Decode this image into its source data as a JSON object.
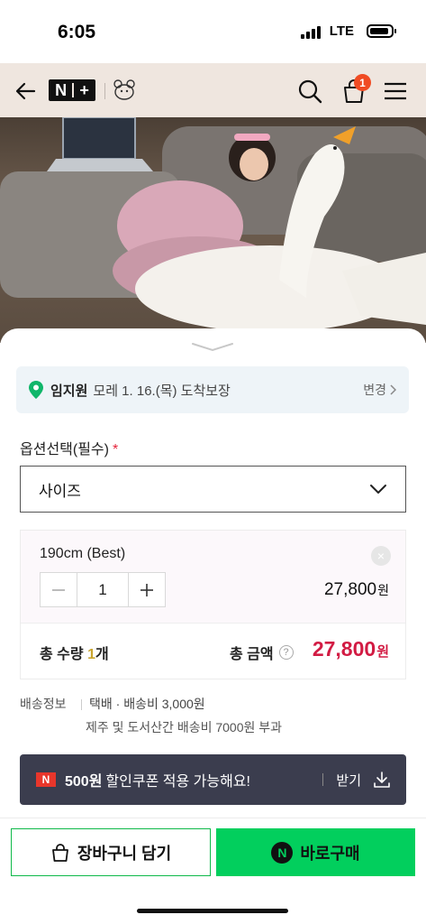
{
  "status_bar": {
    "time": "6:05",
    "network": "LTE"
  },
  "header": {
    "cart_count": "1"
  },
  "delivery": {
    "name": "임지원",
    "date": "모레 1. 16.(목) 도착보장",
    "change_label": "변경"
  },
  "options": {
    "label": "옵션선택(필수)",
    "required_mark": "*",
    "select_value": "사이즈"
  },
  "selected_item": {
    "name": "190cm (Best)",
    "remove_symbol": "×",
    "quantity": "1",
    "price": "27,800",
    "price_unit": "원"
  },
  "totals": {
    "qty_prefix": "총 수량 ",
    "qty_value": "1",
    "qty_unit": "개",
    "amount_label": "총 금액",
    "help_symbol": "?",
    "amount": "27,800",
    "amount_unit": "원"
  },
  "shipping": {
    "label": "배송정보",
    "line1": "택배 · 배송비 3,000원",
    "line2": "제주 및 도서산간 배송비 7000원 부과"
  },
  "coupon": {
    "logo": "N",
    "amount": "500원",
    "text": "할인쿠폰 적용 가능해요!",
    "get_label": "받기"
  },
  "actions": {
    "add_to_cart": "장바구니 담기",
    "buy_now": "바로구매",
    "npay_logo": "N"
  },
  "colors": {
    "accent_green": "#02cf5d",
    "price_red": "#d21b43",
    "header_bg": "#efe6df",
    "coupon_bg": "#3b3d4e"
  }
}
